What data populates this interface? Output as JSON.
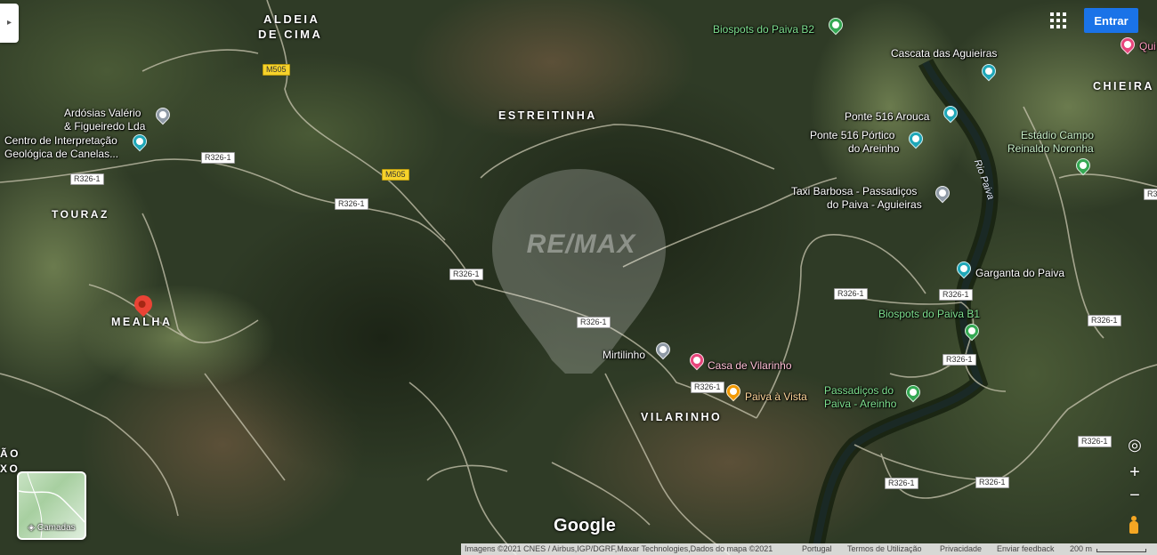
{
  "header": {
    "signin_label": "Entrar"
  },
  "places": [
    {
      "id": "aldeia",
      "text": "ALDEIA"
    },
    {
      "id": "decima",
      "text": "DE CIMA"
    },
    {
      "id": "estreitinha",
      "text": "ESTREITINHA"
    },
    {
      "id": "touraz",
      "text": "TOURAZ"
    },
    {
      "id": "mealha",
      "text": "MEALHA"
    },
    {
      "id": "vilarinho",
      "text": "VILARINHO"
    },
    {
      "id": "chieira",
      "text": "CHIEIRA"
    },
    {
      "id": "ao",
      "text": "ÃO"
    },
    {
      "id": "xo",
      "text": "XO"
    }
  ],
  "pois": {
    "biospots_b2": "Biospots do Paiva B2",
    "cascata": "Cascata das Aguieiras",
    "quinta": "Qui",
    "ponte516_arouca": "Ponte 516 Arouca",
    "ponte516_portico_1": "Ponte 516 Pórtico",
    "ponte516_portico_2": "do Areinho",
    "estadio_1": "Estádio Campo",
    "estadio_2": "Reinaldo Noronha",
    "taxi_1": "Taxi Barbosa - Passadiços",
    "taxi_2": "do Paiva - Aguieiras",
    "garganta": "Garganta do Paiva",
    "biospots_b1": "Biospots do Paiva B1",
    "ardosias_1": "Ardósias Valério",
    "ardosias_2": "& Figueiredo Lda",
    "centro_1": "Centro de Interpretação",
    "centro_2": "Geológica de Canelas...",
    "mirtilinho": "Mirtilinho",
    "casa_vilarinho": "Casa de Vilarinho",
    "paiva_vista": "Paiva à Vista",
    "passadicos_1": "Passadiços do",
    "passadicos_2": "Paiva - Areinho"
  },
  "river_label": "Rio Paiva",
  "roads": {
    "m505": "M505",
    "r3261": "R326-1"
  },
  "watermark": "RE/MAX",
  "layers_label": "Camadas",
  "google_logo": "Google",
  "footer": {
    "imagery": "Imagens ©2021 CNES / Airbus,IGP/DGRF,Maxar Technologies,Dados do mapa ©2021",
    "country": "Portugal",
    "terms": "Termos de Utilização",
    "privacy": "Privacidade",
    "feedback": "Enviar feedback",
    "scale": "200 m"
  },
  "colors": {
    "signin_bg": "#1a73e8",
    "pin_red": "#ea4335",
    "poi_teal": "#1fa7b8",
    "poi_green": "#34a853",
    "poi_pink": "#e8457c",
    "poi_orange": "#f29900",
    "poi_gray": "#8f9aa6"
  }
}
